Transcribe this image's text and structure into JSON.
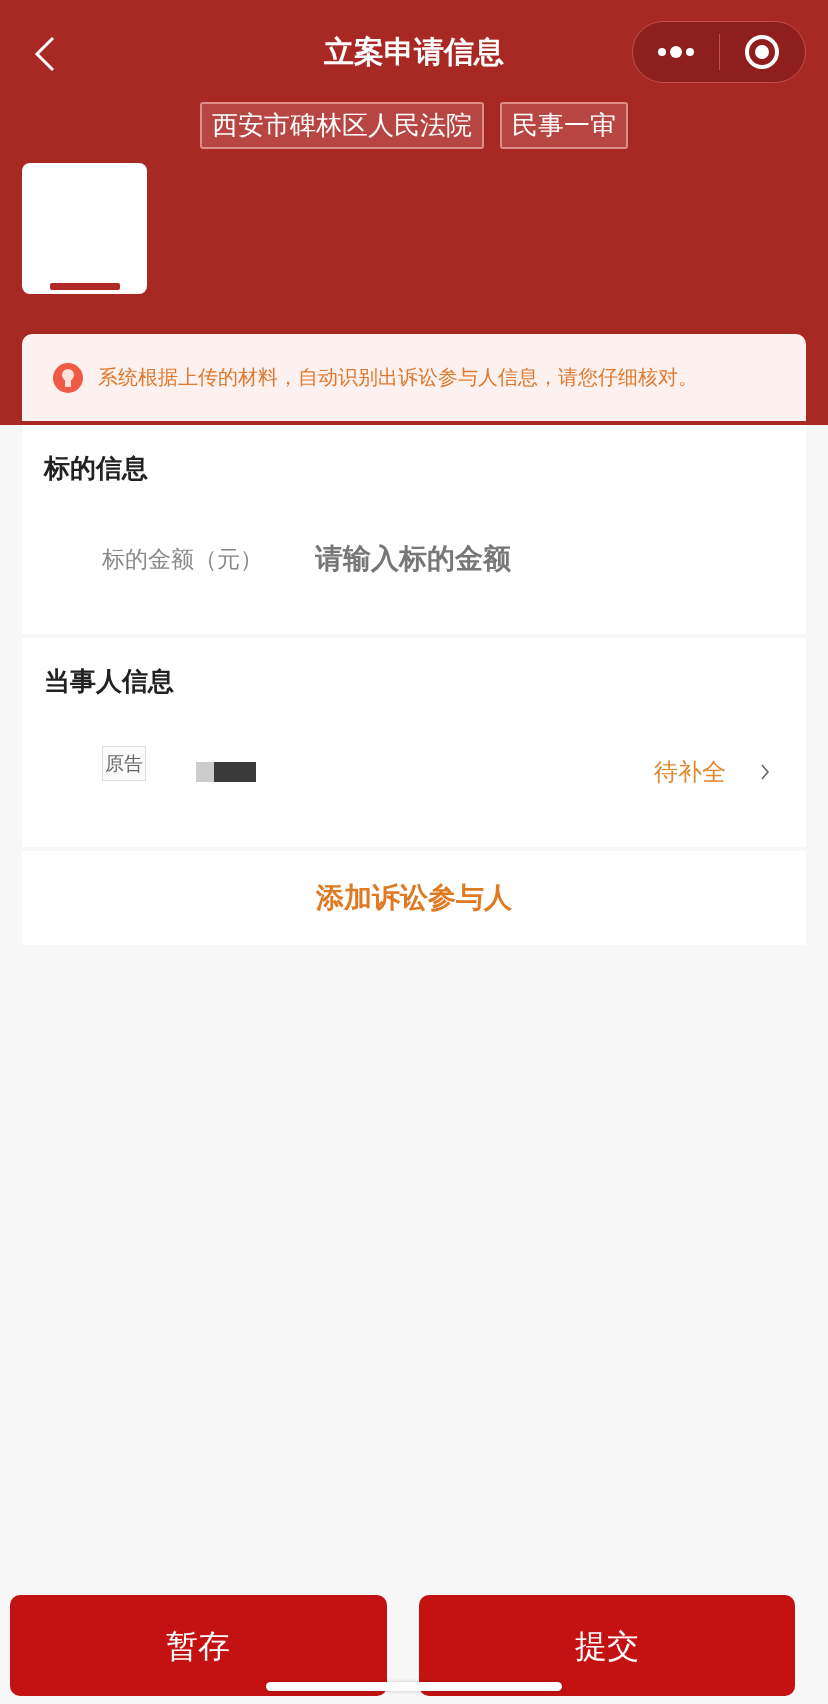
{
  "nav_bar": {
    "title": "立案申请信息"
  },
  "tags": [
    "西安市碑林区人民法院",
    "民事一审"
  ],
  "notice": "系统根据上传的材料，自动识别出诉讼参与人信息，请您仔细核对。",
  "subject_section": {
    "title": "标的信息",
    "field_label": "标的金额（元）",
    "placeholder": "请输入标的金额"
  },
  "party_section": {
    "title": "当事人信息",
    "parties": [
      {
        "role": "原告",
        "status": "待补全"
      }
    ]
  },
  "add_party": "添加诉讼参与人",
  "buttons": [
    "暂存",
    "提交"
  ]
}
